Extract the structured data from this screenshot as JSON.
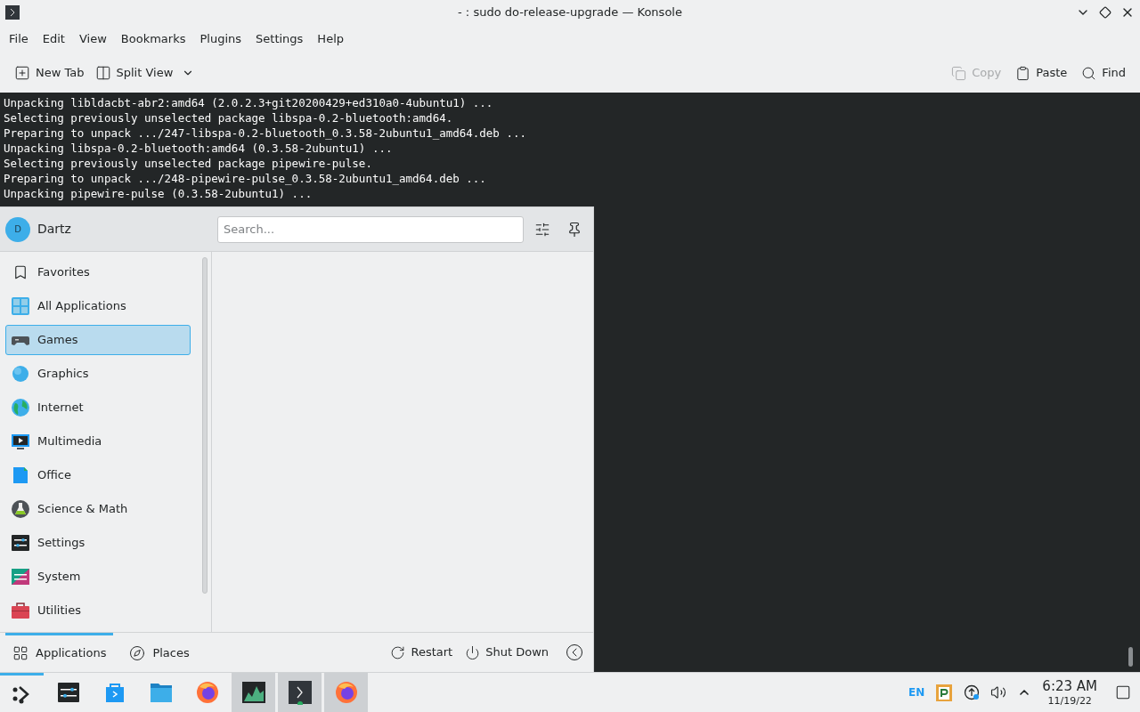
{
  "window": {
    "title": "- : sudo do-release-upgrade — Konsole"
  },
  "menu_bar": [
    "File",
    "Edit",
    "View",
    "Bookmarks",
    "Plugins",
    "Settings",
    "Help"
  ],
  "toolbar": {
    "left": [
      {
        "label": "New Tab",
        "disabled": false
      },
      {
        "label": "Split View",
        "disabled": false
      }
    ],
    "right": [
      {
        "label": "Copy",
        "disabled": true
      },
      {
        "label": "Paste",
        "disabled": false
      },
      {
        "label": "Find",
        "disabled": false
      }
    ]
  },
  "terminal_lines": [
    "Unpacking libldacbt-abr2:amd64 (2.0.2.3+git20200429+ed310a0-4ubuntu1) ...",
    "Selecting previously unselected package libspa-0.2-bluetooth:amd64.",
    "Preparing to unpack .../247-libspa-0.2-bluetooth_0.3.58-2ubuntu1_amd64.deb ...",
    "Unpacking libspa-0.2-bluetooth:amd64 (0.3.58-2ubuntu1) ...",
    "Selecting previously unselected package pipewire-pulse.",
    "Preparing to unpack .../248-pipewire-pulse_0.3.58-2ubuntu1_amd64.deb ...",
    "Unpacking pipewire-pulse (0.3.58-2ubuntu1) ..."
  ],
  "launcher": {
    "user": {
      "initial": "D",
      "name": "Dartz"
    },
    "search": {
      "placeholder": "Search..."
    },
    "categories": [
      {
        "label": "Favorites",
        "selected": false
      },
      {
        "label": "All Applications",
        "selected": false
      },
      {
        "label": "Games",
        "selected": true
      },
      {
        "label": "Graphics",
        "selected": false
      },
      {
        "label": "Internet",
        "selected": false
      },
      {
        "label": "Multimedia",
        "selected": false
      },
      {
        "label": "Office",
        "selected": false
      },
      {
        "label": "Science & Math",
        "selected": false
      },
      {
        "label": "Settings",
        "selected": false
      },
      {
        "label": "System",
        "selected": false
      },
      {
        "label": "Utilities",
        "selected": false
      }
    ],
    "tabs": [
      {
        "label": "Applications",
        "selected": true
      },
      {
        "label": "Places",
        "selected": false
      }
    ],
    "actions": [
      "Restart",
      "Shut Down"
    ]
  },
  "taskbar": {
    "items": [
      {
        "running": false
      },
      {
        "running": false
      },
      {
        "running": false
      },
      {
        "running": false
      },
      {
        "running": false
      },
      {
        "running": true
      },
      {
        "running": true
      },
      {
        "running": true
      }
    ],
    "keyboard_layout": "EN",
    "time": "6:23 AM",
    "date": "11/19/22"
  }
}
